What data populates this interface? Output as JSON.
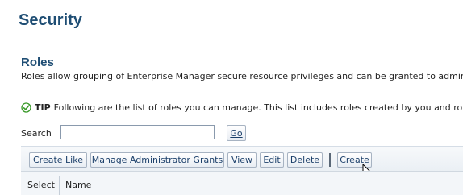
{
  "page_title": "Security",
  "roles": {
    "title": "Roles",
    "description": "Roles allow grouping of Enterprise Manager secure resource privileges and can be granted to admini",
    "tip_label": "TIP",
    "tip_text": "Following are the list of roles you can manage. This list includes roles created by you and role"
  },
  "search": {
    "label": "Search",
    "value": "",
    "go_label": "Go"
  },
  "toolbar": {
    "create_like": "Create Like",
    "manage_grants": "Manage Administrator Grants",
    "view": "View",
    "edit": "Edit",
    "delete": "Delete",
    "create": "Create"
  },
  "table": {
    "columns": [
      "Select",
      "Name"
    ]
  },
  "icons": {
    "tip": "checkmark-circle-icon",
    "cursor": "mouse-pointer-icon"
  },
  "colors": {
    "heading": "#1f4e74",
    "button_text": "#1b3f6a",
    "tip_check": "#3a9a2a"
  }
}
